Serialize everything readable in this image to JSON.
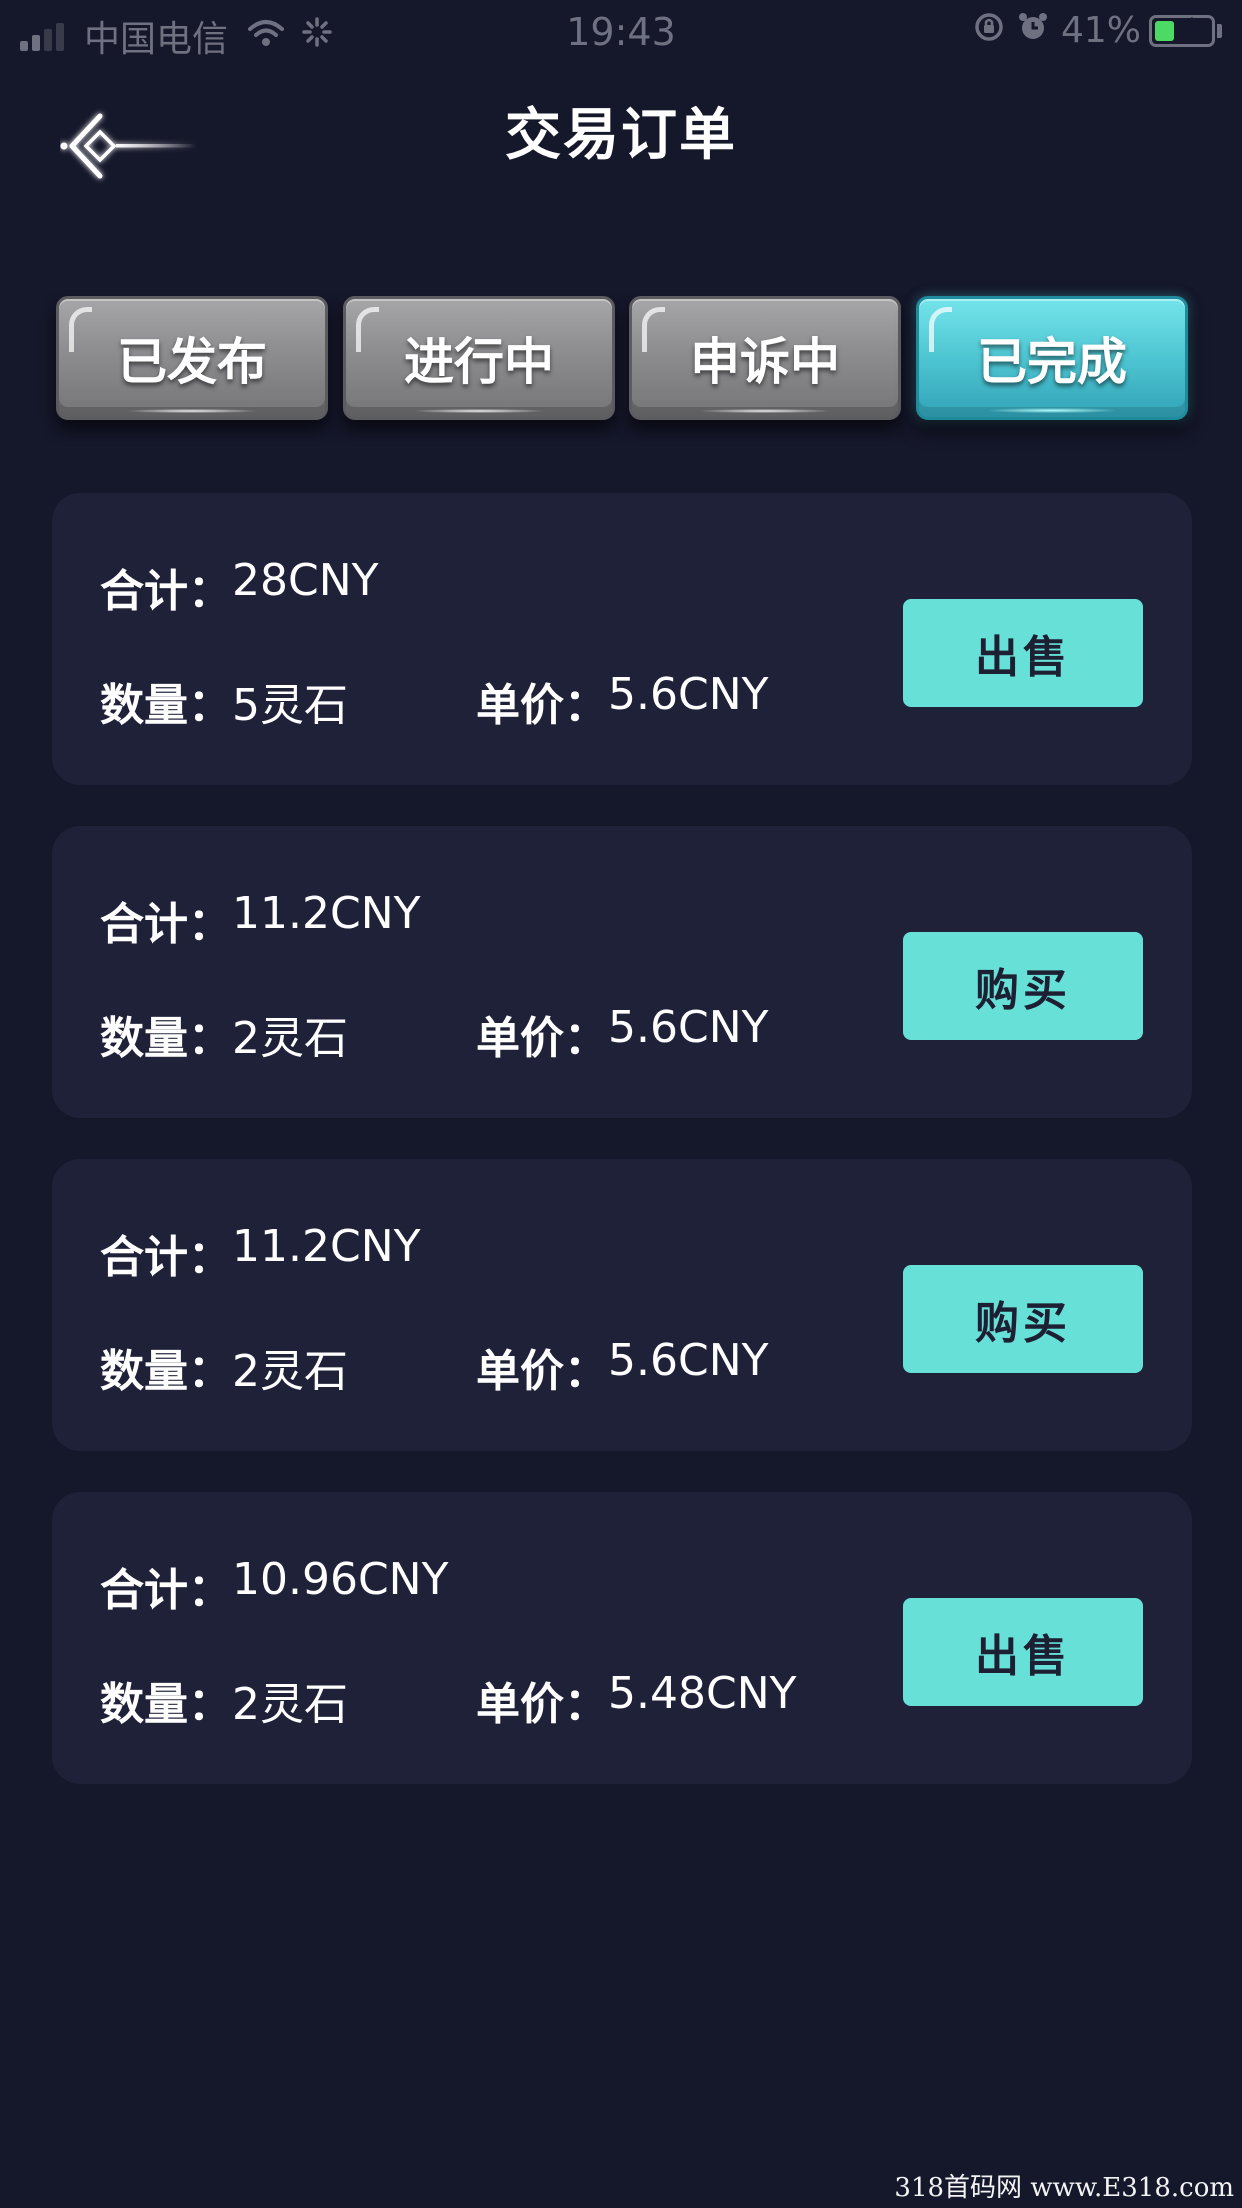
{
  "status_bar": {
    "carrier": "中国电信",
    "time": "19:43",
    "battery": "41%",
    "battery_level": 0.41,
    "icons": [
      "signal-icon",
      "wifi-icon",
      "loading-icon",
      "rotation-lock-icon",
      "alarm-icon",
      "battery-icon"
    ]
  },
  "header": {
    "title": "交易订单",
    "back_icon": "back-arrow-icon"
  },
  "tabs": [
    {
      "label": "已发布",
      "active": false
    },
    {
      "label": "进行中",
      "active": false
    },
    {
      "label": "申诉中",
      "active": false
    },
    {
      "label": "已完成",
      "active": true
    }
  ],
  "orders": [
    {
      "total_label": "合计：",
      "total": "28CNY",
      "qty_label": "数量：",
      "qty": "5灵石",
      "price_label": "单价：",
      "price": "5.6CNY",
      "action": "出售"
    },
    {
      "total_label": "合计：",
      "total": "11.2CNY",
      "qty_label": "数量：",
      "qty": "2灵石",
      "price_label": "单价：",
      "price": "5.6CNY",
      "action": "购买"
    },
    {
      "total_label": "合计：",
      "total": "11.2CNY",
      "qty_label": "数量：",
      "qty": "2灵石",
      "price_label": "单价：",
      "price": "5.6CNY",
      "action": "购买"
    },
    {
      "total_label": "合计：",
      "total": "10.96CNY",
      "qty_label": "数量：",
      "qty": "2灵石",
      "price_label": "单价：",
      "price": "5.48CNY",
      "action": "出售"
    }
  ],
  "colors": {
    "background": "#15172a",
    "card": "#1f2139",
    "accent": "#67e0d8",
    "tab_inactive": "#8d8d90",
    "tab_active": "#4ec5d2"
  },
  "watermark": "318首码网 www.E318.com"
}
